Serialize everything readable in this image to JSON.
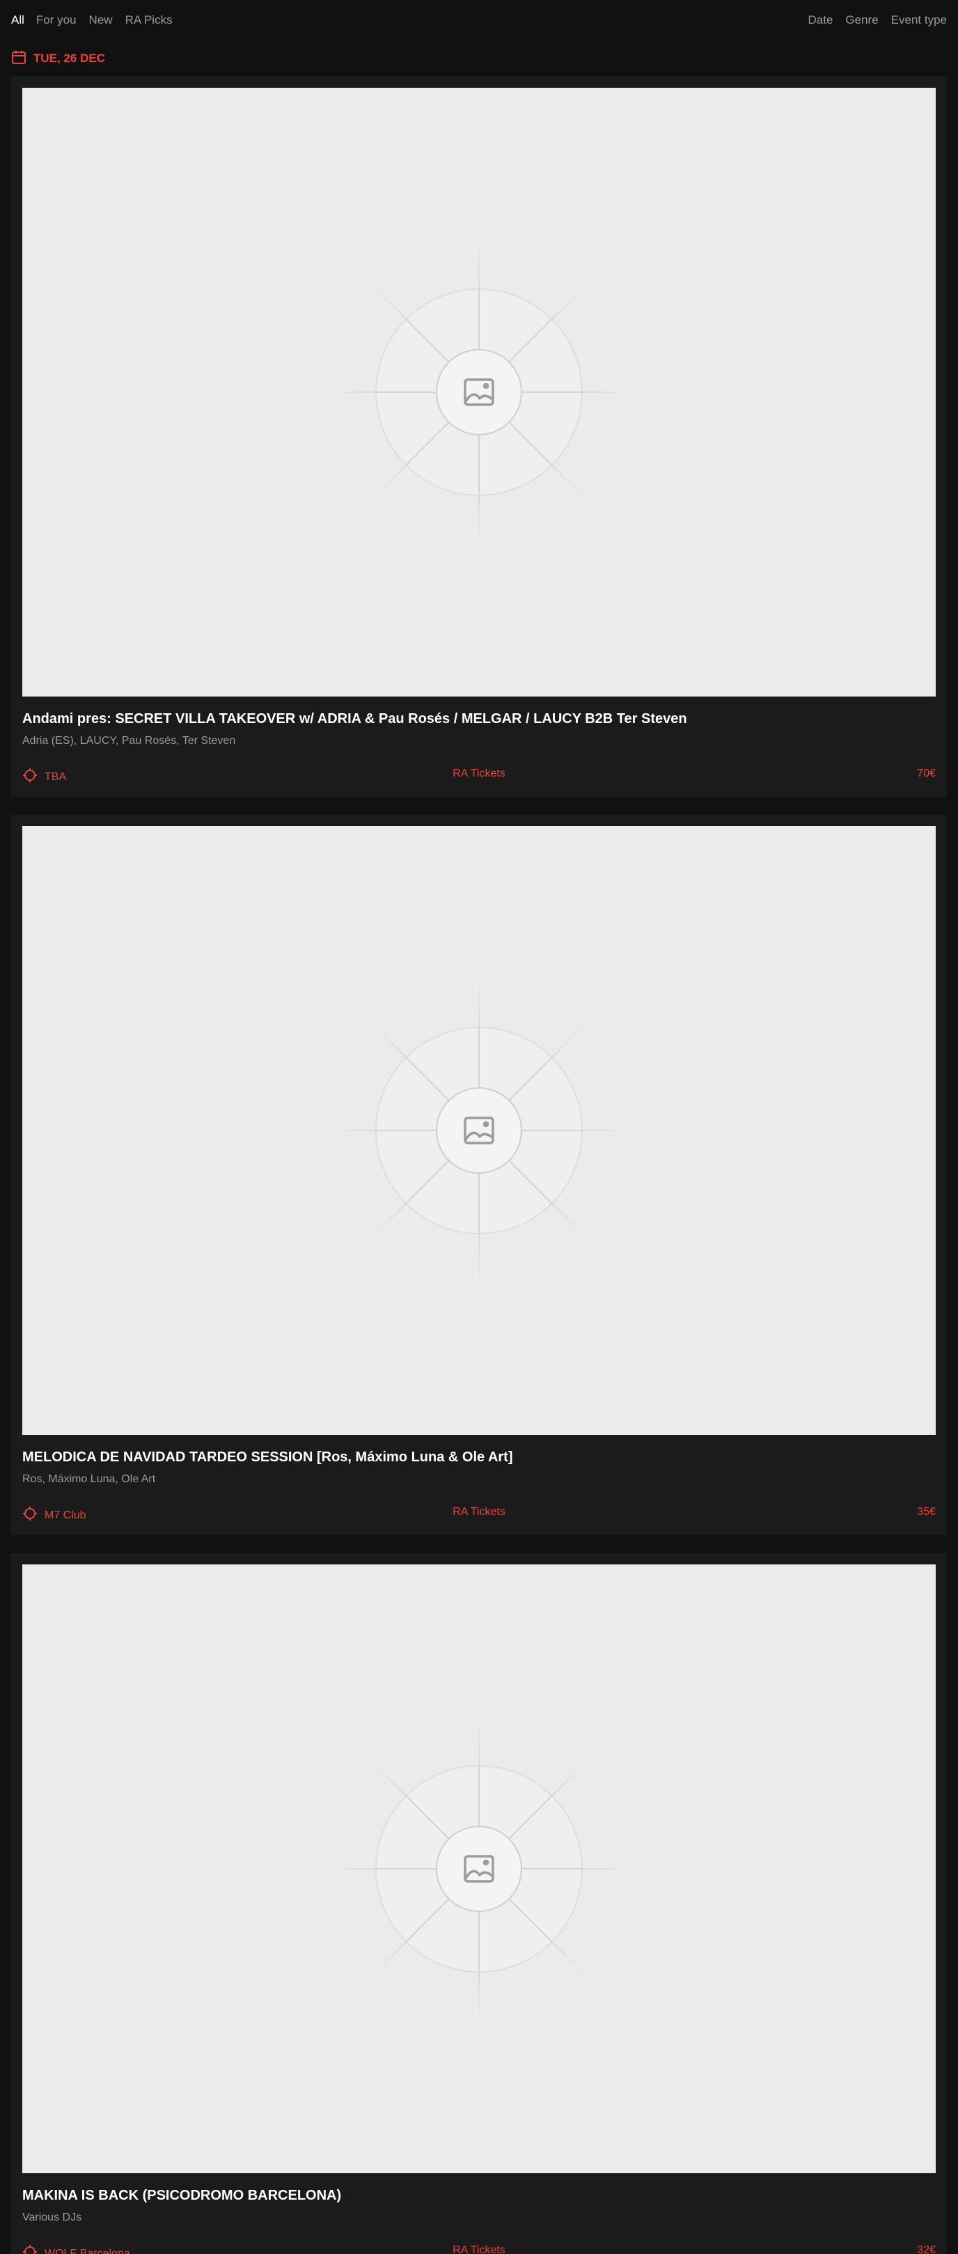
{
  "nav": {
    "tabs": [
      {
        "label": "All"
      },
      {
        "label": "For you"
      },
      {
        "label": "New"
      },
      {
        "label": "RA Picks"
      }
    ],
    "filters": [
      {
        "label": "Date"
      },
      {
        "label": "Genre"
      },
      {
        "label": "Event type"
      }
    ]
  },
  "date_header": {
    "label": "TUE, 26 DEC",
    "icon": "calendar-icon"
  },
  "colors": {
    "accent": "#e8453c",
    "background": "#111111",
    "card": "#1b1b1b",
    "muted_text": "#9a9a9a"
  },
  "events": [
    {
      "title": "Andami pres: SECRET VILLA TAKEOVER w/ ADRIA & Pau Rosés / MELGAR / LAUCY B2B Ter Steven",
      "artists": "Adria (ES), LAUCY, Pau Rosés, Ter Steven",
      "venue": "TBA",
      "tickets": "RA Tickets",
      "price": "70€"
    },
    {
      "title": "MELODICA DE NAVIDAD TARDEO SESSION [Ros, Máximo Luna & Ole Art]",
      "artists": "Ros, Máximo Luna, Ole Art",
      "venue": "M7 Club",
      "tickets": "RA Tickets",
      "price": "35€"
    },
    {
      "title": "MAKINA IS BACK (PSICODROMO BARCELONA)",
      "artists": "Various DJs",
      "venue": "WOLF Barcelona",
      "tickets": "RA Tickets",
      "price": "32€"
    }
  ]
}
